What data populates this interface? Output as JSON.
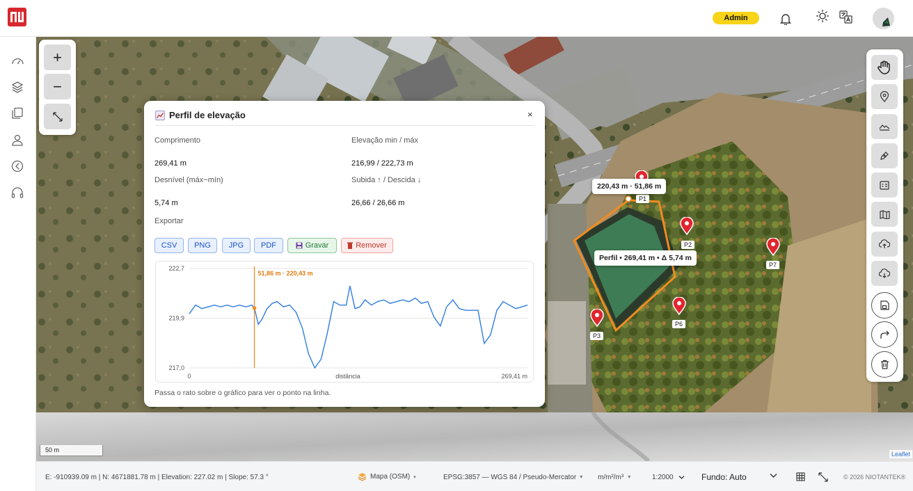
{
  "header": {
    "logo": "logo-mark",
    "role_badge": "Admin",
    "icons": [
      "bell-icon",
      "sun-icon",
      "translate-icon"
    ]
  },
  "sidebar": {
    "items": [
      "dashboard-icon",
      "layers-icon",
      "documents-icon",
      "user-icon",
      "compass-icon",
      "headset-icon"
    ]
  },
  "map": {
    "zoom_in": "+",
    "zoom_out": "−",
    "scale": "50 m",
    "attribution": "Leaflet",
    "tooltip_point": "220,43 m · 51,86 m",
    "tooltip_profile": "Perfil • 269,41 m • Δ 5,74 m",
    "points": [
      "P1",
      "P2",
      "P3",
      "P6",
      "P7"
    ]
  },
  "panel": {
    "title": "Perfil de elevação",
    "close": "×",
    "stats": {
      "length_label": "Comprimento",
      "length_value": "269,41 m",
      "elev_label": "Elevação min / máx",
      "elev_value": "216,99 / 222,73 m",
      "gap_label": "Desnível (máx−mín)",
      "gap_value": "5,74 m",
      "updown_label": "Subida ↑ / Descida ↓",
      "updown_value": "26,66 / 26,66 m"
    },
    "export_label": "Exportar",
    "buttons": {
      "csv": "CSV",
      "png": "PNG",
      "jpg": "JPG",
      "pdf": "PDF",
      "save": "Gravar",
      "remove": "Remover"
    },
    "hint": "Passa o rato sobre o gráfico para ver o ponto na linha."
  },
  "chart_data": {
    "type": "line",
    "xlabel": "distância",
    "xlim": [
      0,
      269.41
    ],
    "ylim": [
      217.0,
      222.7
    ],
    "yticks": [
      "222,7",
      "219,9",
      "217,0"
    ],
    "xticks": [
      "0",
      "269,41 m"
    ],
    "cursor": {
      "x": 51.86,
      "y": 220.43,
      "label": "51,86 m · 220,43 m"
    },
    "series": [
      {
        "color": "#2f7de1",
        "x": [
          0,
          5,
          10,
          15,
          20,
          25,
          30,
          35,
          40,
          45,
          50,
          52,
          55,
          58,
          62,
          66,
          70,
          75,
          80,
          85,
          90,
          95,
          100,
          105,
          110,
          115,
          120,
          125,
          128,
          132,
          136,
          140,
          145,
          150,
          155,
          160,
          165,
          170,
          175,
          180,
          185,
          190,
          195,
          200,
          205,
          210,
          215,
          220,
          225,
          230,
          235,
          240,
          245,
          250,
          255,
          260,
          265,
          269.41
        ],
        "y": [
          220.1,
          220.6,
          220.4,
          220.5,
          220.6,
          220.5,
          220.6,
          220.5,
          220.6,
          220.5,
          220.6,
          220.4,
          219.5,
          219.8,
          220.4,
          220.7,
          220.8,
          220.5,
          220.6,
          220.2,
          219.3,
          217.8,
          217.0,
          217.5,
          219.0,
          220.8,
          220.6,
          220.6,
          221.7,
          220.4,
          220.5,
          220.9,
          220.6,
          220.8,
          220.9,
          220.7,
          220.8,
          220.9,
          220.8,
          221.0,
          220.7,
          220.8,
          219.9,
          219.4,
          220.5,
          220.9,
          220.4,
          220.3,
          220.3,
          220.3,
          218.4,
          218.9,
          220.3,
          220.8,
          220.6,
          220.4,
          220.5,
          220.6
        ]
      }
    ]
  },
  "status_bar": {
    "coords": "E: -910939.09 m   |   N: 4671881.78 m   |   Elevation: 227.02 m   |   Slope: 57.3 °",
    "basemap": "Mapa (OSM)",
    "crs": "EPSG:3857 — WGS 84 / Pseudo-Mercator",
    "units": "m/m²/m³",
    "scale": "1:2000",
    "background": "Fundo: Auto",
    "copyright": "© 2026 NIOTANTEK®"
  },
  "toolbar": {
    "tools": [
      "hand-icon",
      "pin-icon",
      "elevation-icon",
      "pen-icon",
      "table-icon",
      "map-icon",
      "cloud-upload-icon",
      "cloud-download-icon",
      "save-icon",
      "share-icon",
      "trash-icon"
    ]
  }
}
